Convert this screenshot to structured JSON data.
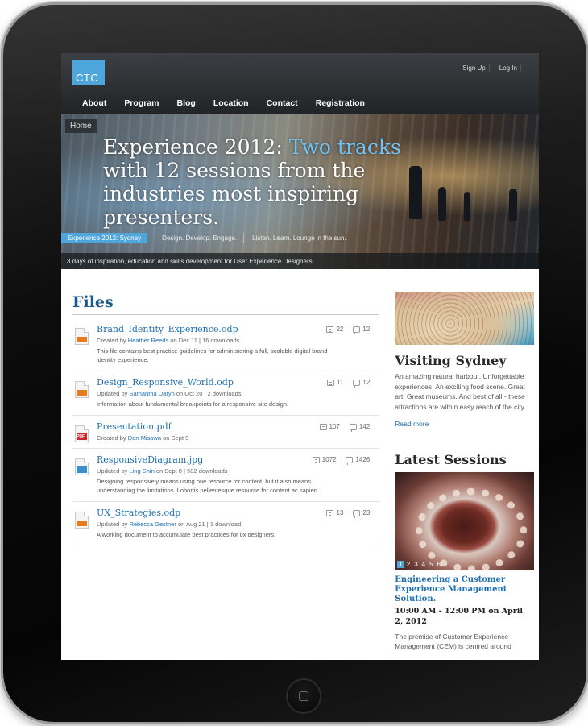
{
  "site": {
    "logo": "CTC",
    "user_links": [
      "Sign Up",
      "Log In"
    ],
    "nav": [
      "About",
      "Program",
      "Blog",
      "Location",
      "Contact",
      "Registration"
    ]
  },
  "hero": {
    "breadcrumb": "Home",
    "title_main": "Experience 2012:",
    "title_accent": "Two tracks",
    "title_rest": "with 12 sessions from the industries most inspiring presenters.",
    "tabs": [
      "Experience 2012: Sydney",
      "Design. Develop. Engage.",
      "Listen. Learn. Lounge in the sun."
    ],
    "caption": "3 days of inspiration, education and skills development for User Experience Designers."
  },
  "files": {
    "title": "Files",
    "items": [
      {
        "name": "Brand_Identity_Experience.odp",
        "type": "odp",
        "meta_prefix": "Created by",
        "user": "Heather Reeds",
        "meta_suffix": "on Dec 11  |  16 downloads",
        "desc": "This file contains best practice guidelines for administering a full, scalable digital brand identity experience.",
        "views": "22",
        "comments": "12"
      },
      {
        "name": "Design_Responsive_World.odp",
        "type": "odp",
        "meta_prefix": "Updated by",
        "user": "Samantha Daryn",
        "meta_suffix": "on Oct 20  |  2 downloads",
        "desc": "Information about fundamental breakpoints for a responsive site design.",
        "views": "11",
        "comments": "12"
      },
      {
        "name": "Presentation.pdf",
        "type": "pdf",
        "meta_prefix": "Created by",
        "user": "Dan Misawa",
        "meta_suffix": "on Sept 9",
        "desc": "",
        "views": "107",
        "comments": "142"
      },
      {
        "name": "ResponsiveDiagram.jpg",
        "type": "jpg",
        "meta_prefix": "Updated by",
        "user": "Ling Shin",
        "meta_suffix": "on Sept 8  |  502 downloads",
        "desc": "Designing responsively means using one resource for content, but it also means understanding the limitations. Lobortis pellentesque resource for content ac sapien...",
        "views": "1072",
        "comments": "1426"
      },
      {
        "name": "UX_Strategies.odp",
        "type": "odp",
        "meta_prefix": "Updated by",
        "user": "Rebecca Gestner",
        "meta_suffix": "on Aug 21  |  1 download",
        "desc": "A working document to accumulate best practices for ux designers.",
        "views": "13",
        "comments": "23"
      }
    ]
  },
  "sidebar": {
    "visiting": {
      "title": "Visiting Sydney",
      "text": "An amazing natural harbour. Unforgettable experiences. An exciting food scene. Great art. Great museums. And best of all - these attractions are within easy reach of the city.",
      "read_more": "Read more"
    },
    "sessions": {
      "title": "Latest Sessions",
      "pager": [
        "1",
        "2",
        "3",
        "4",
        "5",
        "6"
      ],
      "session_title": "Engineering a Customer Experience Management Solution.",
      "time": "10:00 AM - 12:00 PM on April 2, 2012",
      "desc": "The premise of Customer Experience Management (CEM) is centred around"
    }
  }
}
